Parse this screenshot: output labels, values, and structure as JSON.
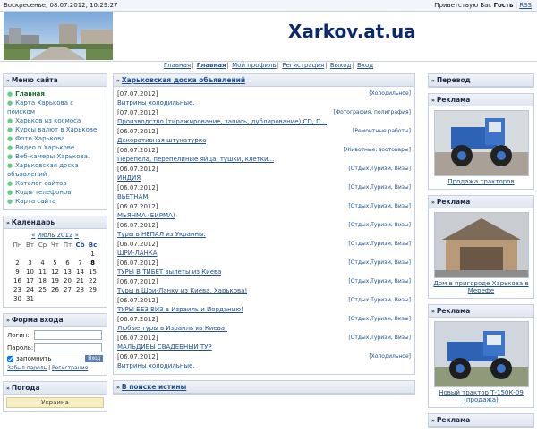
{
  "topbar": {
    "date": "Воскресенье, 08.07.2012, 10:29:27",
    "greeting": "Приветствую Вас",
    "user": "Гость",
    "rss": "RSS"
  },
  "header": {
    "logo": "Xarkov.at.ua"
  },
  "nav": {
    "items": [
      "Главная",
      "Главная",
      "Мой профиль",
      "Регистрация",
      "Выход",
      "Вход"
    ]
  },
  "menu": {
    "title": "Меню сайта",
    "items": [
      "Главная",
      "Карта Харькова с поиском",
      "Харьков из космоса",
      "Курсы валют в Харькове",
      "Фото Харькова",
      "Видео о Харькове",
      "Веб-камеры Харькова.",
      "Харьковская доска объявлений",
      "Каталог сайтов",
      "Коды телефонов",
      "Карта сайта"
    ]
  },
  "calendar": {
    "title": "Календарь",
    "prev": "«",
    "month": "Июль 2012",
    "next": "»",
    "days": [
      "Пн",
      "Вт",
      "Ср",
      "Чт",
      "Пт",
      "Сб",
      "Вс"
    ],
    "weeks": [
      [
        "",
        "",
        "",
        "",
        "",
        "",
        "1"
      ],
      [
        "2",
        "3",
        "4",
        "5",
        "6",
        "7",
        "8"
      ],
      [
        "9",
        "10",
        "11",
        "12",
        "13",
        "14",
        "15"
      ],
      [
        "16",
        "17",
        "18",
        "19",
        "20",
        "21",
        "22"
      ],
      [
        "23",
        "24",
        "25",
        "26",
        "27",
        "28",
        "29"
      ],
      [
        "30",
        "31",
        "",
        "",
        "",
        "",
        ""
      ]
    ]
  },
  "login": {
    "title": "Форма входа",
    "login_label": "Логин:",
    "password_label": "Пароль:",
    "remember": "запомнить",
    "submit": "Вход",
    "forgot": "Забыл пароль",
    "register": "Регистрация"
  },
  "weather": {
    "title": "Погода",
    "region": "Украина"
  },
  "board": {
    "title": "Харьковская доска объявлений",
    "items": [
      {
        "date": "[07.07.2012]",
        "cat": "[Холодильное]",
        "title": "Витрины холодильные."
      },
      {
        "date": "[07.07.2012]",
        "cat": "[Фотография, полиграфия]",
        "title": "Производство (тиражирование, запись, дублирование) CD, D..."
      },
      {
        "date": "[06.07.2012]",
        "cat": "[Ремонтные работы]",
        "title": "Декоративная штукатурка"
      },
      {
        "date": "[06.07.2012]",
        "cat": "[Животные, зоотовары]",
        "title": "Перепела, перепелиные яйца, тушки, клетки..."
      },
      {
        "date": "[06.07.2012]",
        "cat": "[Отдых,Туризм, Визы]",
        "title": "ИНДИЯ"
      },
      {
        "date": "[06.07.2012]",
        "cat": "[Отдых,Туризм, Визы]",
        "title": "ВЬЕТНАМ"
      },
      {
        "date": "[06.07.2012]",
        "cat": "[Отдых,Туризм, Визы]",
        "title": "МЬЯНМА (БИРМА)"
      },
      {
        "date": "[06.07.2012]",
        "cat": "[Отдых,Туризм, Визы]",
        "title": "Туры в НЕПАЛ из Украины."
      },
      {
        "date": "[06.07.2012]",
        "cat": "[Отдых,Туризм, Визы]",
        "title": "ШРИ-ЛАНКА"
      },
      {
        "date": "[06.07.2012]",
        "cat": "[Отдых,Туризм, Визы]",
        "title": "ТУРЫ В ТИБЕТ вылеты из Киева"
      },
      {
        "date": "[06.07.2012]",
        "cat": "[Отдых,Туризм, Визы]",
        "title": "Туры в Шри-Ланку из Киева, Харькова!"
      },
      {
        "date": "[06.07.2012]",
        "cat": "[Отдых,Туризм, Визы]",
        "title": "ТУРЫ БЕЗ ВИЗ в Израиль и Иорданию!"
      },
      {
        "date": "[06.07.2012]",
        "cat": "[Отдых,Туризм, Визы]",
        "title": "Любые туры в Израиль из Киева!"
      },
      {
        "date": "[06.07.2012]",
        "cat": "[Отдых,Туризм, Визы]",
        "title": "МАЛЬДИВЫ СВАДЕБНЫЙ ТУР"
      },
      {
        "date": "[06.07.2012]",
        "cat": "[Холодильное]",
        "title": "Витрины холодильные."
      }
    ]
  },
  "truth": {
    "title": "В поиске истины"
  },
  "right": {
    "translate_title": "Перевод",
    "ads": [
      {
        "title": "Реклама",
        "caption": "Продажа тракторов"
      },
      {
        "title": "Реклама",
        "caption": "Дом в пригороде Харькова в Мерефе"
      },
      {
        "title": "Реклама",
        "caption": "Новый трактор Т-150К-09 (продажа)"
      },
      {
        "title": "Реклама",
        "caption": ""
      }
    ]
  },
  "colors": {
    "accent": "#1f4e8c",
    "logo": "#0c2a6b",
    "tractor": "#2d62b4"
  }
}
